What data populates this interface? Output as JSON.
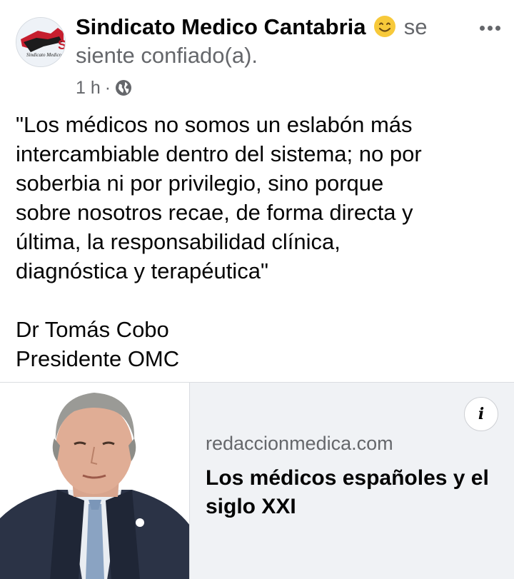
{
  "post": {
    "page_name": "Sindicato Medico Cantabria",
    "feeling_emoji": "smiling-face-icon",
    "feeling_prefix": "se",
    "feeling_text": "siente confiado(a).",
    "time": "1 h",
    "separator": "·",
    "audience_icon": "globe-icon",
    "avatar_text": "Sindicato Medico",
    "avatar_initial": "S",
    "more_icon": "more-options-icon",
    "body": "\"Los médicos no somos un eslabón más\nintercambiable dentro del sistema; no por\nsoberbia ni por privilegio, sino porque\nsobre nosotros recae, de forma directa y\núltima, la responsabilidad clínica,\ndiagnóstica y terapéutica\"\n\nDr Tomás Cobo\nPresidente OMC"
  },
  "link_preview": {
    "info_label": "i",
    "domain": "redaccionmedica.com",
    "headline": "Los médicos españoles y el siglo XXI"
  },
  "colors": {
    "secondary_text": "#65676b",
    "primary_text": "#050505",
    "card_background": "#f0f2f5",
    "emoji_yellow": "#f7c93a"
  }
}
